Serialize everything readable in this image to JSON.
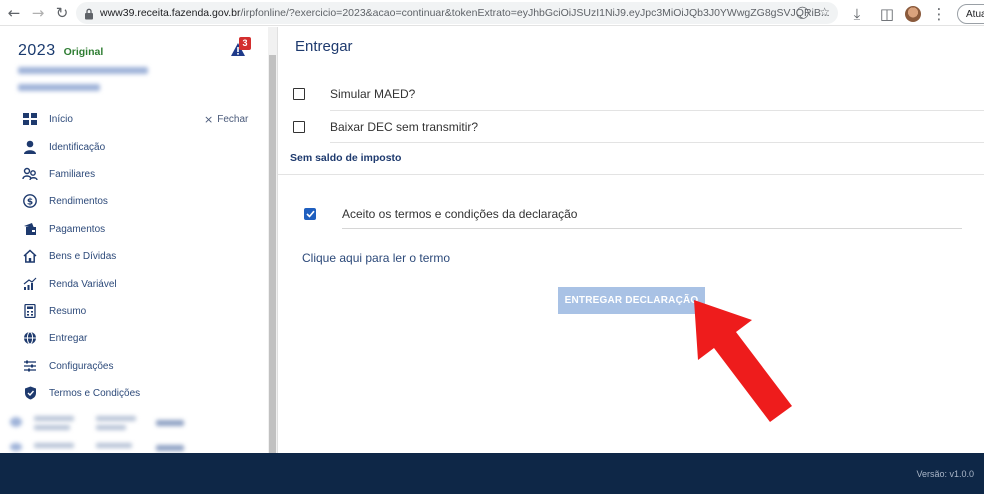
{
  "browser": {
    "url_host": "www39.receita.fazenda.gov.br",
    "url_path": "/irpfonline/?exercicio=2023&acao=continuar&tokenExtrato=eyJhbGciOiJSUzI1NiJ9.eyJpc3MiOiJQb3J0YWwgZG8gSVJQRiB...",
    "update_label": "Atualizar"
  },
  "sidebar": {
    "year": "2023",
    "status": "Original",
    "alert_count": "3",
    "close_label": "Fechar",
    "items": [
      {
        "label": "Início",
        "icon": "grid-icon"
      },
      {
        "label": "Identificação",
        "icon": "person-icon"
      },
      {
        "label": "Familiares",
        "icon": "family-icon"
      },
      {
        "label": "Rendimentos",
        "icon": "dollar-icon"
      },
      {
        "label": "Pagamentos",
        "icon": "payment-icon"
      },
      {
        "label": "Bens e Dívidas",
        "icon": "house-icon"
      },
      {
        "label": "Renda Variável",
        "icon": "chart-icon"
      },
      {
        "label": "Resumo",
        "icon": "calculator-icon"
      },
      {
        "label": "Entregar",
        "icon": "globe-icon"
      },
      {
        "label": "Configurações",
        "icon": "sliders-icon"
      },
      {
        "label": "Termos e Condições",
        "icon": "shield-icon"
      }
    ]
  },
  "main": {
    "title": "Entregar",
    "options": [
      {
        "label": "Simular MAED?",
        "checked": false
      },
      {
        "label": "Baixar DEC sem transmitir?",
        "checked": false
      }
    ],
    "section_label": "Sem saldo de imposto",
    "accept_label": "Aceito os termos e condições da declaração",
    "accept_checked": true,
    "terms_link": "Clique aqui para ler o termo",
    "submit_label": "ENTREGAR DECLARAÇÃO"
  },
  "footer": {
    "version": "Versão: v1.0.0"
  },
  "colors": {
    "brand_dark": "#0e2747",
    "primary": "#1e3a6e",
    "button_disabled": "#a9c2e5",
    "annotation_arrow": "#ee1c1c",
    "status_green": "#2e7d32"
  }
}
